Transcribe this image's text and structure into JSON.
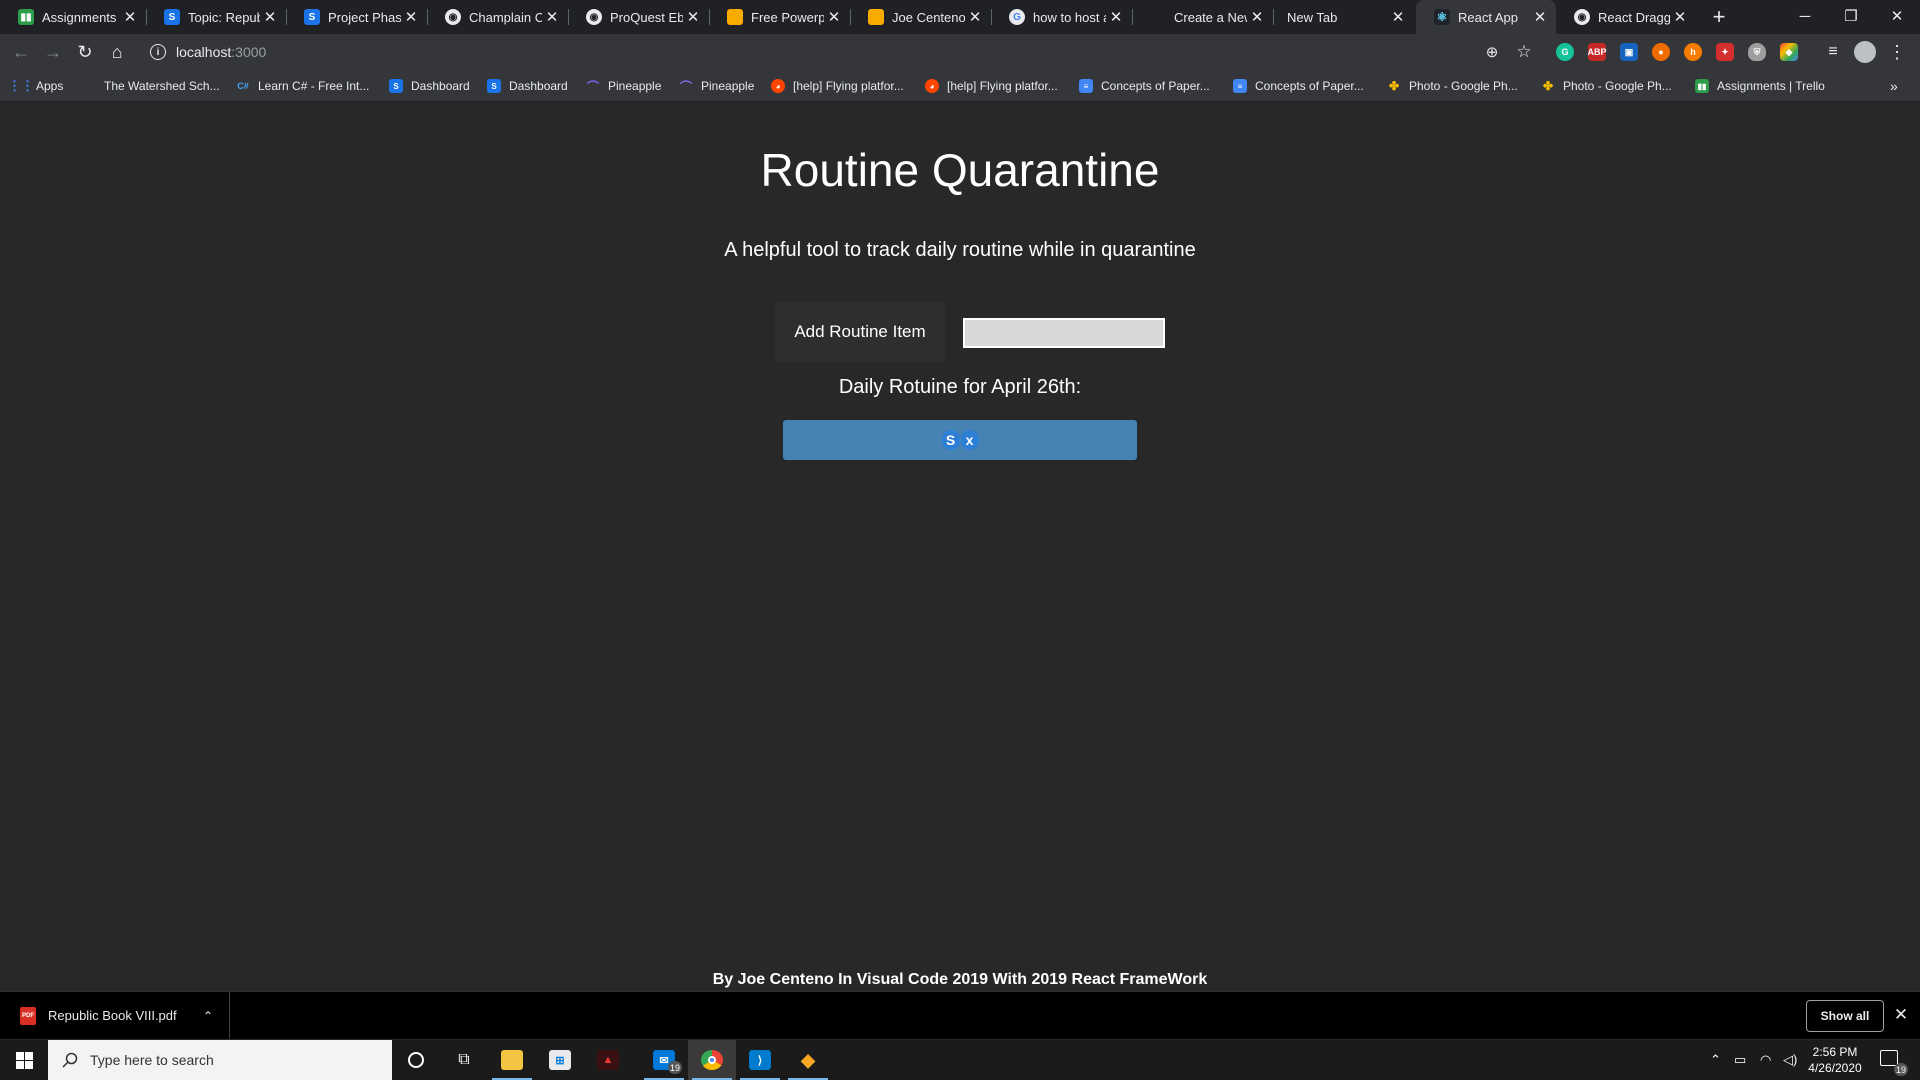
{
  "browser": {
    "tabs": [
      {
        "title": "Assignments |",
        "icon": "trello-icon",
        "color": "#2e9d4b"
      },
      {
        "title": "Topic: Republic",
        "icon": "schoology-icon",
        "color": "#1a73e8"
      },
      {
        "title": "Project Phase",
        "icon": "schoology-icon",
        "color": "#1a73e8"
      },
      {
        "title": "Champlain Col",
        "icon": "globe-icon",
        "color": "#e8eaed"
      },
      {
        "title": "ProQuest Ebo",
        "icon": "globe-icon",
        "color": "#e8eaed"
      },
      {
        "title": "Free Powerpo",
        "icon": "slides-icon",
        "color": "#f9ab00"
      },
      {
        "title": "Joe Centeno V",
        "icon": "slides-icon",
        "color": "#f9ab00"
      },
      {
        "title": "how to host a",
        "icon": "google-icon",
        "color": "#e8eaed"
      },
      {
        "title": "Create a New",
        "icon": "github-icon",
        "color": "#202124"
      },
      {
        "title": "New Tab",
        "icon": "",
        "color": ""
      },
      {
        "title": "React App",
        "icon": "react-icon",
        "color": "#61dafb"
      },
      {
        "title": "React Draggab",
        "icon": "globe-icon",
        "color": "#e8eaed"
      }
    ],
    "address": {
      "host": "localhost",
      "port": ":3000"
    },
    "bookmarks": [
      {
        "label": "Apps",
        "icon": "apps-grid-icon",
        "color": "#4285f4"
      },
      {
        "label": "The Watershed Sch...",
        "icon": "watershed-icon",
        "color": "#5f6368"
      },
      {
        "label": "Learn C# - Free Int...",
        "icon": "csharp-icon",
        "color": "#1565c0"
      },
      {
        "label": "Dashboard",
        "icon": "schoology-icon",
        "color": "#1a73e8"
      },
      {
        "label": "Dashboard",
        "icon": "schoology-icon",
        "color": "#1a73e8"
      },
      {
        "label": "Pineapple",
        "icon": "pineapple-icon",
        "color": "#7b68ee"
      },
      {
        "label": "Pineapple",
        "icon": "pineapple-icon",
        "color": "#7b68ee"
      },
      {
        "label": "[help] Flying platfor...",
        "icon": "reddit-icon",
        "color": "#ff4500"
      },
      {
        "label": "[help] Flying platfor...",
        "icon": "reddit-icon",
        "color": "#ff4500"
      },
      {
        "label": "Concepts of Paper...",
        "icon": "docs-icon",
        "color": "#4285f4"
      },
      {
        "label": "Concepts of Paper...",
        "icon": "docs-icon",
        "color": "#4285f4"
      },
      {
        "label": "Photo - Google Ph...",
        "icon": "photos-icon",
        "color": "#fbbc04"
      },
      {
        "label": "Photo - Google Ph...",
        "icon": "photos-icon",
        "color": "#fbbc04"
      },
      {
        "label": "Assignments | Trello",
        "icon": "trello-icon",
        "color": "#2e9d4b"
      }
    ]
  },
  "page": {
    "title": "Routine Quarantine",
    "subtitle": "A helpful tool to track daily routine while in quarantine",
    "add_button_label": "Add Routine Item",
    "input_value": "",
    "daily_label": "Daily Rotuine for April 26th:",
    "routine_items": [
      {
        "text": "S",
        "delete_label": "x"
      }
    ],
    "footer": "By Joe Centeno In Visual Code 2019 With 2019 React FrameWork",
    "colors": {
      "background": "#282828",
      "item_bg": "#4682b4",
      "text": "#ffffff"
    }
  },
  "downloads": {
    "file_name": "Republic Book VIII.pdf",
    "file_type": "PDF",
    "show_all_label": "Show all"
  },
  "taskbar": {
    "search_placeholder": "Type here to search",
    "mail_badge": "19",
    "time": "2:56 PM",
    "date": "4/26/2020",
    "notification_count": "19"
  }
}
